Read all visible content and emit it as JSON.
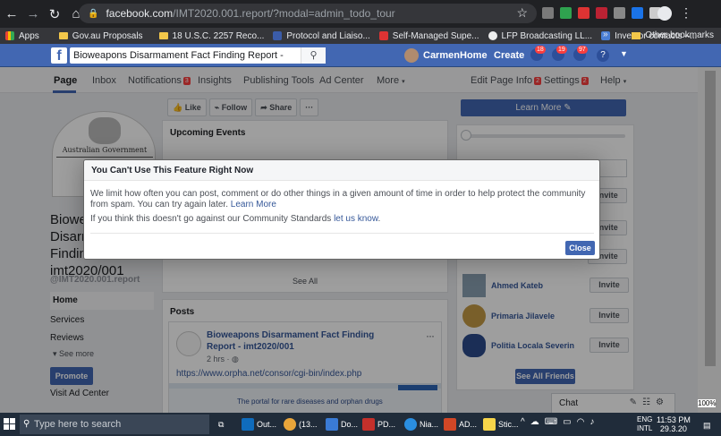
{
  "browser": {
    "url_host": "facebook.com",
    "url_path": "/IMT2020.001.report/?modal=admin_todo_tour",
    "bookmarks": [
      {
        "label": "Apps"
      },
      {
        "label": "Gov.au Proposals"
      },
      {
        "label": "18 U.S.C. 2257 Reco..."
      },
      {
        "label": "Protocol and Liaiso..."
      },
      {
        "label": "Self-Managed Supe..."
      },
      {
        "label": "LFP Broadcasting LL..."
      },
      {
        "label": "Investor contacts –..."
      }
    ],
    "other_bookmarks": "Other bookmarks",
    "overflow": "»"
  },
  "fb_header": {
    "logo": "f",
    "search_value": "Bioweapons Disarmament Fact Finding Report - imt2020/001",
    "user_name": "Carmen",
    "home": "Home",
    "create": "Create",
    "badges": [
      "18",
      "19",
      "97"
    ],
    "help": "?"
  },
  "page_nav": {
    "page": "Page",
    "inbox": "Inbox",
    "notifications": "Notifications",
    "notifications_count": "3",
    "insights": "Insights",
    "publishing_tools": "Publishing Tools",
    "ad_center": "Ad Center",
    "more": "More",
    "edit_page_info": "Edit Page Info",
    "edit_page_info_count": "2",
    "settings": "Settings",
    "settings_count": "2",
    "help": "Help"
  },
  "left": {
    "gov_text": "Australian Government",
    "page_name": "Bioweapons Disarmament Fact Finding Report - imt2020/001",
    "page_name_line1": "Biowe",
    "page_name_line2": "Disarm",
    "page_name_line3": "Findin",
    "page_name_line4": "imt2020/001",
    "handle": "@IMT2020.001.report",
    "nav": [
      "Home",
      "Services",
      "Reviews"
    ],
    "see_more": "See more",
    "promote": "Promote",
    "visit_ad_center": "Visit Ad Center"
  },
  "center": {
    "like": "Like",
    "follow": "Follow",
    "share": "Share",
    "more_dots": "···",
    "upcoming_events": "Upcoming Events",
    "see_all": "See All",
    "posts": "Posts",
    "post": {
      "title": "Bioweapons Disarmament Fact Finding Report - imt2020/001",
      "time": "2 hrs · ",
      "link": "https://www.orpha.net/consor/cgi-bin/index.php",
      "preview_text": "The portal for rare diseases and orphan drugs",
      "dots": "···"
    }
  },
  "right": {
    "learn_more": "Learn More",
    "invite_label": "Invite",
    "friends": [
      {
        "name": "Ahmed Kateb"
      },
      {
        "name": "Primaria Jilavele"
      },
      {
        "name": "Politia Locala Severin"
      }
    ],
    "see_all_friends": "See All Friends",
    "chat": "Chat"
  },
  "modal": {
    "title": "You Can't Use This Feature Right Now",
    "body1": "We limit how often you can post, comment or do other things in a given amount of time in order to help protect the community from spam. You can try again later.",
    "learn_more": "Learn More",
    "body2": "If you think this doesn't go against our Community Standards",
    "let_us_know": "let us know",
    "close": "Close"
  },
  "taskbar": {
    "search_placeholder": "Type here to search",
    "items": [
      {
        "label": "Out..."
      },
      {
        "label": "(13..."
      },
      {
        "label": "Do..."
      },
      {
        "label": "PD..."
      },
      {
        "label": "Nia..."
      },
      {
        "label": "AD..."
      },
      {
        "label": "Stic..."
      }
    ],
    "lang": "ENG",
    "lang2": "INTL",
    "time": "11:53 PM",
    "date": "29.3.20"
  },
  "zoom": "100%",
  "colors": {
    "fb_blue": "#4267b2",
    "link": "#365899",
    "badge_red": "#fa3e3e"
  }
}
